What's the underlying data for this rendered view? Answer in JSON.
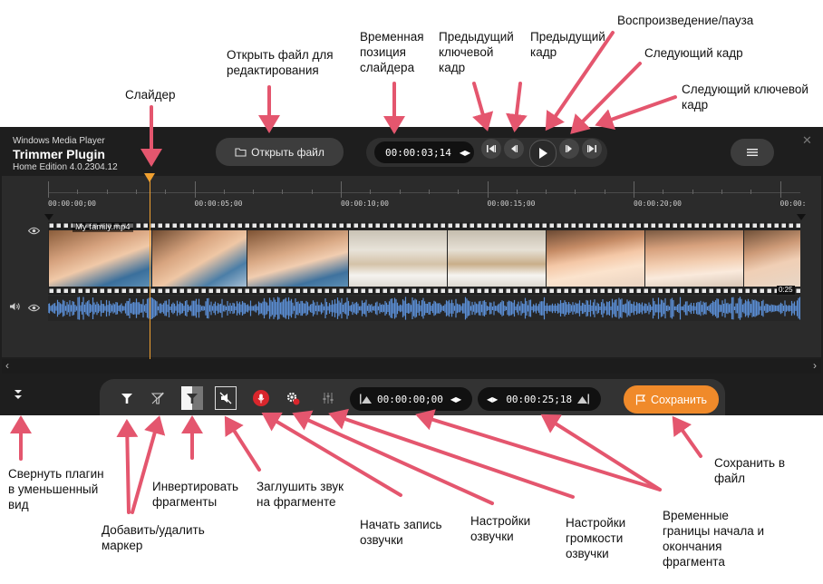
{
  "annotations": {
    "slider": "Слайдер",
    "open_file": "Открыть файл для\nредактирования",
    "slider_position": "Временная\nпозиция\nслайдера",
    "prev_keyframe": "Предыдущий\nключевой\nкадр",
    "prev_frame": "Предыдущий\nкадр",
    "play_pause": "Воспроизведение/пауза",
    "next_frame": "Следующий кадр",
    "next_keyframe": "Следующий ключевой\nкадр",
    "collapse": "Свернуть плагин\nв уменьшенный\nвид",
    "add_remove_marker": "Добавить/удалить\nмаркер",
    "invert": "Инвертировать\nфрагменты",
    "mute": "Заглушить звук\nна фрагменте",
    "record_voice": "Начать запись\nозвучки",
    "voice_settings": "Настройки\nозвучки",
    "voice_volume": "Настройки\nгромкости\nозвучки",
    "time_bounds": "Временные\nграницы начала и\nокончания\nфрагмента",
    "save_to_file": "Сохранить в\nфайл"
  },
  "app": {
    "vendor": "Windows Media Player",
    "name": "Trimmer Plugin",
    "edition": "Home Edition 4.0.2304.12"
  },
  "toolbar": {
    "open_file_label": "Открыть файл",
    "current_time": "00:00:03;14",
    "start_time": "00:00:00;00",
    "end_time": "00:00:25;18",
    "save_label": "Сохранить"
  },
  "timeline": {
    "ticks": [
      "00:00:00;00",
      "00:00:05;00",
      "00:00:10;00",
      "00:00:15;00",
      "00:00:20;00",
      "00:00:"
    ],
    "clip_name": "My family.mp4",
    "clip_end_label": "0:25",
    "slider_seconds": 3.47
  },
  "icons": {
    "eye": "eye-icon",
    "speaker": "speaker-icon",
    "menu": "hamburger-icon",
    "close": "close-icon",
    "folder": "folder-icon"
  },
  "colors": {
    "accent": "#f08a2a",
    "arrow": "#e4566e",
    "waveform": "#5b8fd6",
    "record": "#d9262c"
  }
}
